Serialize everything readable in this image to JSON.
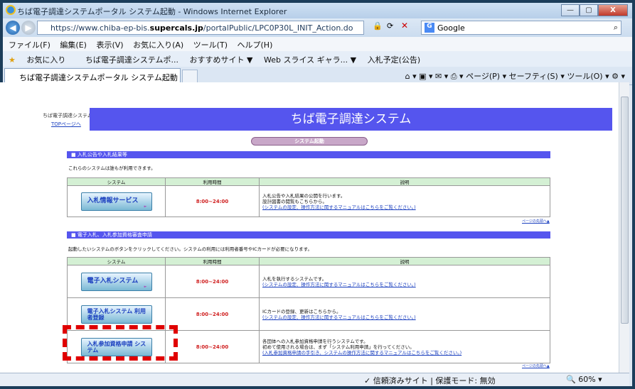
{
  "window": {
    "title": "ちば電子調達システムポータル システム起動 - Windows Internet Explorer",
    "buttons": [
      "—",
      "▢",
      "X"
    ]
  },
  "address": {
    "url_prefix": "https://www.chiba-ep-bis.",
    "url_domain": "supercals.jp",
    "url_path": "/portalPublic/LPC0P30L_INIT_Action.do",
    "search_engine": "Google"
  },
  "menu": [
    "ファイル(F)",
    "編集(E)",
    "表示(V)",
    "お気に入り(A)",
    "ツール(T)",
    "ヘルプ(H)"
  ],
  "favorites": {
    "label": "お気に入り",
    "items": [
      "ちば電子調達システムポ...",
      "おすすめサイト ▼",
      "Web スライス ギャラ... ▼",
      "入札予定(公告)"
    ]
  },
  "tab": {
    "label": "ちば電子調達システムポータル システム起動"
  },
  "commands": "ページ(P) ▾  セーフティ(S) ▾  ツール(O) ▾",
  "page": {
    "logo": "ちば電子調達システム",
    "top_link": "TOPページへ",
    "banner": "ちば電子調達システム",
    "pill": "システム起動",
    "section1": {
      "title": "■ 入札公告や入札結果等",
      "note": "これらのシステムは誰もが利用できます。",
      "headers": [
        "システム",
        "利用時間",
        "説明"
      ],
      "rows": [
        {
          "btn": "入札情報サービス",
          "btn_sub": "►",
          "hours": "8:00~24:00",
          "d1": "入札公告や入札結果の公開を行います。",
          "d2": "設計図書の閲覧もこちらから。",
          "d3": "(システムの設定、操作方法に関するマニュアルはこちらをご覧ください。)"
        }
      ]
    },
    "pagetop": "ページの先頭へ▲",
    "section2": {
      "title": "■ 電子入札、入札参加資格審査申請",
      "note": "起動したいシステムのボタンをクリックしてください。システムの利用には利用者番号やICカードが必要になります。",
      "headers": [
        "システム",
        "利用時間",
        "説明"
      ],
      "rows": [
        {
          "btn": "電子入札システム",
          "btn_sub": "►",
          "hours": "8:00~24:00",
          "d1": "入札を執行するシステムです。",
          "d2": "(システムの設定、操作方法に関するマニュアルはこちらをご覧ください。)"
        },
        {
          "btn": "電子入札システム 利用者登録",
          "hours": "8:00~24:00",
          "d1": "ICカードの登録、更新はこちらから。",
          "d2": "(システムの設定、操作方法に関するマニュアルはこちらをご覧ください。)"
        },
        {
          "btn": "入札参加資格申請 システム",
          "hours": "8:00~24:00",
          "d1": "各団体への入札参加資格申請を行うシステムです。",
          "d2": "初めて使用される場合は、まず「システム利用申請」を行ってください。",
          "d3": "(入札参加資格申請の手引き、システムの操作方法に関するマニュアルはこちらをご覧ください。)"
        }
      ]
    }
  },
  "status": {
    "trust": "✓ 信頼済みサイト | 保護モード: 無効",
    "zoom": "🔍 60% ▾"
  }
}
